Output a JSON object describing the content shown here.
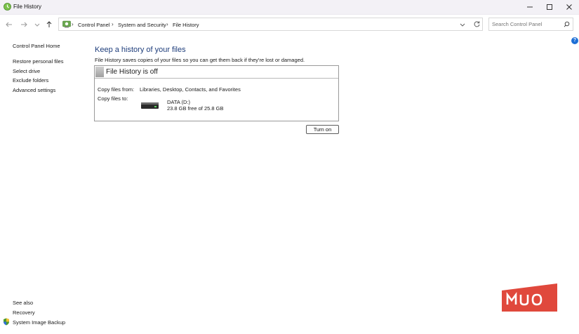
{
  "window": {
    "title": "File History"
  },
  "nav": {
    "breadcrumbs": [
      "Control Panel",
      "System and Security",
      "File History"
    ],
    "search_placeholder": "Search Control Panel"
  },
  "sidebar": {
    "home": "Control Panel Home",
    "items": [
      "Restore personal files",
      "Select drive",
      "Exclude folders",
      "Advanced settings"
    ],
    "see_also_label": "See also",
    "see_also": [
      "Recovery",
      "System Image Backup"
    ]
  },
  "main": {
    "heading": "Keep a history of your files",
    "description": "File History saves copies of your files so you can get them back if they're lost or damaged.",
    "status_title": "File History is off",
    "copy_from_label": "Copy files from:",
    "copy_from_value": "Libraries, Desktop, Contacts, and Favorites",
    "copy_to_label": "Copy files to:",
    "drive_name": "DATA (D:)",
    "drive_free": "23.8 GB free of 25.8 GB",
    "turn_on_label": "Turn on"
  },
  "help": {
    "label": "?"
  },
  "watermark": {
    "text": "MUO"
  },
  "colors": {
    "accent": "#1e3d7b",
    "help": "#1d6fd6",
    "watermark": "#e0483c",
    "titlebar": "#f3f1f6"
  },
  "icons": [
    "file-history-icon",
    "minimize-icon",
    "maximize-icon",
    "close-icon",
    "back-arrow-icon",
    "forward-arrow-icon",
    "recent-dropdown-icon",
    "up-arrow-icon",
    "control-panel-icon",
    "chevron-right-icon",
    "chevron-down-icon",
    "refresh-icon",
    "search-icon",
    "drive-icon",
    "shield-icon",
    "help-icon"
  ]
}
